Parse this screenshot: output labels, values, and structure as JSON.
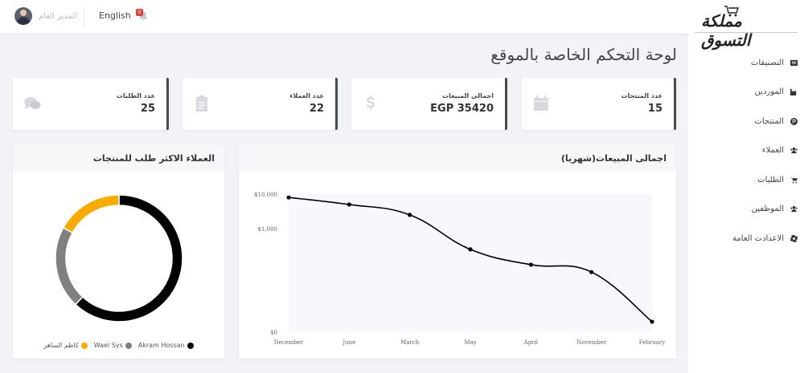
{
  "header": {
    "user_name": "المدير العام",
    "language": "English",
    "notifications_count": "0"
  },
  "sidebar": {
    "logo_text": "مملكة التسوق",
    "items": [
      {
        "label": "التصنيفات",
        "icon": "list-icon"
      },
      {
        "label": "الموردين",
        "icon": "industry-icon"
      },
      {
        "label": "المنتجات",
        "icon": "product-hunt-icon"
      },
      {
        "label": "العملاء",
        "icon": "users-icon"
      },
      {
        "label": "الطلبات",
        "icon": "cart-icon"
      },
      {
        "label": "الموظفين",
        "icon": "users-icon"
      },
      {
        "label": "الاعدادت العامة",
        "icon": "gear-icon"
      }
    ]
  },
  "page_title": "لوحة التحكم الخاصة بالموقع",
  "stats": [
    {
      "label": "عدد المنتجات",
      "value": "15",
      "icon": "calendar-icon"
    },
    {
      "label": "اجمالى المبيعات",
      "value": "EGP 35420",
      "icon": "dollar-icon"
    },
    {
      "label": "عدد العملاء",
      "value": "22",
      "icon": "clipboard-icon"
    },
    {
      "label": "عدد الطلبات",
      "value": "25",
      "icon": "comments-icon"
    }
  ],
  "sales_panel": {
    "title": "اجمالى المبيعات(شهريا)"
  },
  "customers_panel": {
    "title": "العملاء الاكثر طلب للمنتجات"
  },
  "colors": {
    "accent_dark": "#000000",
    "gray": "#808080",
    "yellow": "#f8ab00"
  },
  "chart_data": [
    {
      "type": "line",
      "title": "اجمالى المبيعات(شهريا)",
      "x": [
        "December",
        "June",
        "March",
        "May",
        "April",
        "November",
        "February"
      ],
      "y": [
        8000,
        5000,
        2500,
        250,
        90,
        55,
        2
      ],
      "ylim": [
        1,
        10000
      ],
      "yscale": "log",
      "ytick_labels": [
        "$10,000",
        "$1,000",
        "$0"
      ],
      "xlabel": "",
      "ylabel": "",
      "grid": false
    },
    {
      "type": "pie",
      "variant": "doughnut",
      "title": "العملاء الاكثر طلب للمنتجات",
      "labels": [
        "Akram Hossan",
        "Wael Sys",
        "كاظم الساهر"
      ],
      "values": [
        62,
        21,
        17
      ],
      "colors": [
        "#000000",
        "#808080",
        "#f8ab00"
      ],
      "legend": "bottom"
    }
  ]
}
